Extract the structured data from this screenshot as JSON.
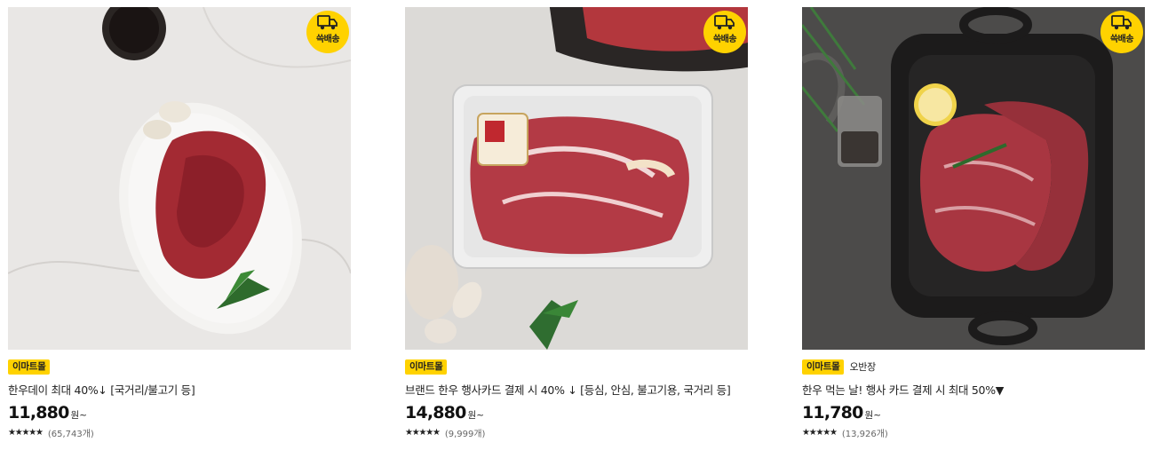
{
  "colors": {
    "accent": "#ffd200",
    "text": "#222222"
  },
  "delivery_badge": {
    "icon": "truck-icon",
    "label": "쓱배송"
  },
  "products": [
    {
      "store": "이마트몰",
      "brand": "",
      "title": "한우데이 최대 40%↓ [국거리/불고기 등]",
      "price": "11,880",
      "price_unit": "원~",
      "rating_stars": 5,
      "stars_text": "★★★★★",
      "review_count": "(65,743개)"
    },
    {
      "store": "이마트몰",
      "brand": "",
      "title": "브랜드 한우 행사카드 결제 시 40% ↓ [등심, 안심, 불고기용, 국거리 등]",
      "price": "14,880",
      "price_unit": "원~",
      "rating_stars": 5,
      "stars_text": "★★★★★",
      "review_count": "(9,999개)"
    },
    {
      "store": "이마트몰",
      "brand": "오반장",
      "title": "한우 먹는 날! 행사 카드 결제 시 최대 50%▼",
      "price": "11,780",
      "price_unit": "원~",
      "rating_stars": 5,
      "stars_text": "★★★★★",
      "review_count": "(13,926개)"
    }
  ]
}
